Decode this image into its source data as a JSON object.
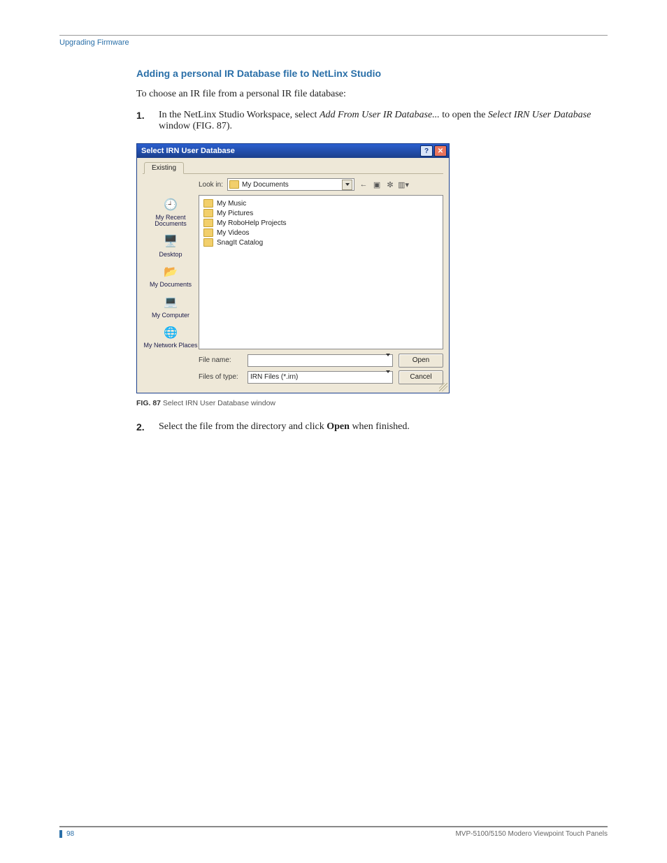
{
  "header": {
    "breadcrumb": "Upgrading Firmware"
  },
  "section": {
    "title": "Adding a personal IR Database file to NetLinx Studio",
    "intro": "To choose an IR file from a personal IR file database:",
    "step1_a": "In the NetLinx Studio Workspace, select ",
    "step1_b": "Add From User IR Database...",
    "step1_c": " to open the ",
    "step1_d": "Select IRN User Database",
    "step1_e": " window (FIG. 87).",
    "step2_a": "Select the file from the directory and click ",
    "step2_b": "Open",
    "step2_c": " when finished."
  },
  "steps": {
    "n1": "1.",
    "n2": "2."
  },
  "dialog": {
    "title": "Select IRN User Database",
    "tab": "Existing",
    "lookin_label": "Look in:",
    "lookin_value": "My Documents",
    "places": {
      "recent": "My Recent Documents",
      "desktop": "Desktop",
      "docs": "My Documents",
      "computer": "My Computer",
      "network": "My Network Places"
    },
    "files": [
      "My Music",
      "My Pictures",
      "My RoboHelp Projects",
      "My Videos",
      "SnagIt Catalog"
    ],
    "filename_label": "File name:",
    "filename_value": "",
    "type_label": "Files of type:",
    "type_value": "IRN Files (*.irn)",
    "open": "Open",
    "cancel": "Cancel",
    "help_glyph": "?",
    "close_glyph": "✕"
  },
  "caption": {
    "fignum": "FIG. 87",
    "text": "  Select IRN User Database window"
  },
  "footer": {
    "page": "98",
    "product": "MVP-5100/5150 Modero Viewpoint  Touch Panels"
  }
}
